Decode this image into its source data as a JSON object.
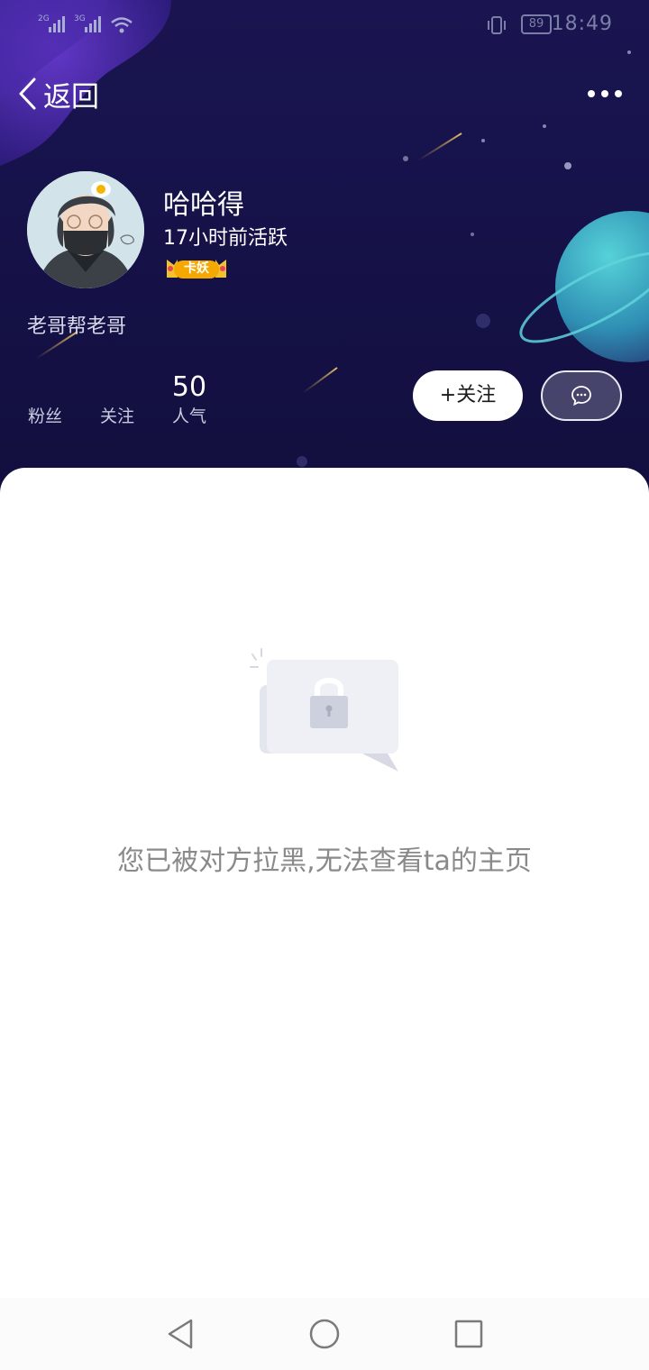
{
  "status_bar": {
    "network_1": "2G",
    "network_2": "3G",
    "battery": "89",
    "time": "18:49",
    "icons": [
      "signal-icon",
      "wifi-icon",
      "vibrate-icon",
      "battery-icon"
    ]
  },
  "nav": {
    "back_label": "返回",
    "more_icon": "more-dots-icon"
  },
  "profile": {
    "name": "哈哈得",
    "active": "17小时前活跃",
    "badge": "卡妖",
    "bio": "老哥帮老哥"
  },
  "stats": [
    {
      "value": "",
      "label": "粉丝"
    },
    {
      "value": "",
      "label": "关注"
    },
    {
      "value": "50",
      "label": "人气"
    }
  ],
  "actions": {
    "follow_label": "+关注",
    "message_icon": "chat-bubble-icon"
  },
  "empty_state": {
    "icon": "lock-icon",
    "message": "您已被对方拉黑,无法查看ta的主页"
  },
  "system_nav": [
    "back-triangle-icon",
    "home-circle-icon",
    "recents-square-icon"
  ],
  "colors": {
    "header_bg": "#16124a",
    "planet": "#3fb6c9",
    "badge": "#f5b400",
    "empty_text": "#8a8a8a"
  }
}
